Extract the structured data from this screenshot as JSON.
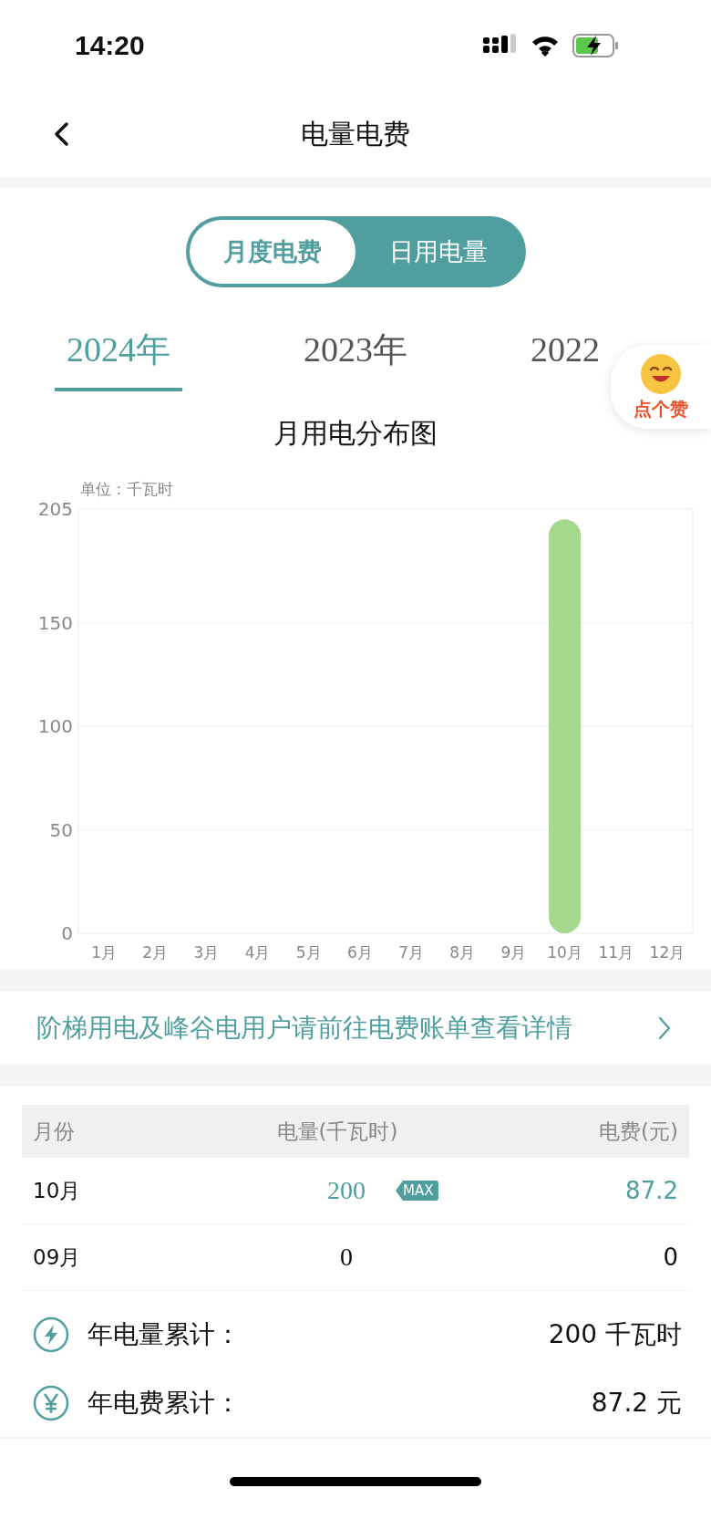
{
  "status_bar": {
    "time": "14:20"
  },
  "nav": {
    "title": "电量电费"
  },
  "toggle": [
    {
      "label": "月度电费",
      "selected": true
    },
    {
      "label": "日用电量",
      "selected": false
    }
  ],
  "year_tabs": [
    {
      "label": "2024年",
      "selected": true
    },
    {
      "label": "2023年",
      "selected": false
    },
    {
      "label": "2022",
      "selected": false
    }
  ],
  "like_badge": {
    "label": "点个赞"
  },
  "chart": {
    "title": "月用电分布图",
    "unit": "单位：千瓦时",
    "chart_data": {
      "type": "bar",
      "categories": [
        "1月",
        "2月",
        "3月",
        "4月",
        "5月",
        "6月",
        "7月",
        "8月",
        "9月",
        "10月",
        "11月",
        "12月"
      ],
      "values": [
        0,
        0,
        0,
        0,
        0,
        0,
        0,
        0,
        0,
        200,
        0,
        0
      ],
      "ylim": [
        0,
        205
      ],
      "grid": true,
      "yticks": [
        0,
        50,
        100,
        150,
        205
      ]
    }
  },
  "notice": {
    "text": "阶梯用电及峰谷电用户请前往电费账单查看详情"
  },
  "table": {
    "columns": [
      "月份",
      "电量(千瓦时)",
      "电费(元)"
    ],
    "rows": [
      {
        "month": "10月",
        "kwh": "200",
        "fee": "87.2",
        "highlighted": true,
        "badge": "MAX"
      },
      {
        "month": "09月",
        "kwh": "0",
        "fee": "0",
        "highlighted": false
      }
    ]
  },
  "summary": [
    {
      "kind": "energy",
      "label": "年电量累计：",
      "value": "200 千瓦时"
    },
    {
      "kind": "cost",
      "label": "年电费累计：",
      "value": "87.2 元"
    }
  ]
}
